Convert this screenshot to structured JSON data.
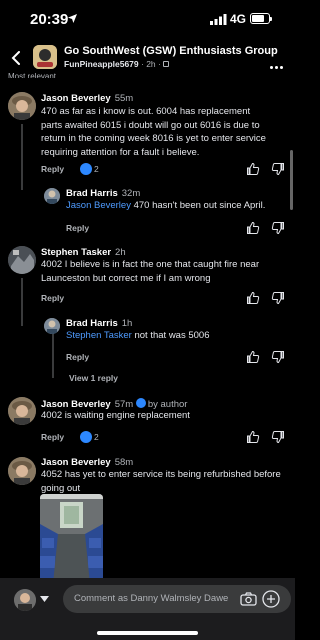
{
  "status": {
    "time": "20:39",
    "network": "4G"
  },
  "header": {
    "group_name": "Go SouthWest (GSW) Enthusiasts Group",
    "poster": "FunPineapple5679",
    "post_age": "2h"
  },
  "partial_label": "Most relevant",
  "labels": {
    "reply": "Reply",
    "view_replies": "View 1 reply",
    "by_author": "by author"
  },
  "comments": [
    {
      "author": "Jason Beverley",
      "time": "55m",
      "text": "470 as far as i know is out. 6004 has replacement parts awaited 6015 i doubt will go out 6016 is due to return in the coming week 8016 is yet to enter service requiring attention for a fault i believe.",
      "reactions": "2"
    },
    {
      "author": "Brad Harris",
      "time": "32m",
      "mention": "Jason Beverley",
      "text": "470 hasn't been out since April."
    },
    {
      "author": "Stephen Tasker",
      "time": "2h",
      "text": "4002 I believe is in fact the one that caught fire near Launceston but correct me if I am wrong"
    },
    {
      "author": "Brad Harris",
      "time": "1h",
      "mention": "Stephen Tasker",
      "text": "not that was 5006"
    },
    {
      "author": "Jason Beverley",
      "time": "57m",
      "text": "4002 is waiting engine replacement",
      "reactions": "2"
    },
    {
      "author": "Jason Beverley",
      "time": "58m",
      "text": "4052 has yet to enter service its being refurbished before going out"
    }
  ],
  "composer": {
    "placeholder": "Comment as Danny Walmsley Dawe"
  },
  "colors": {
    "background": "#000000",
    "accent": "#2d88ff",
    "mention": "#4e9bff",
    "input": "#3a3b3c"
  },
  "icons": [
    "location-arrow-icon",
    "signal-icon",
    "battery-icon",
    "back-chevron-icon",
    "more-icon",
    "like-icon",
    "dislike-icon",
    "camera-icon",
    "plus-icon",
    "chevron-down-icon"
  ]
}
